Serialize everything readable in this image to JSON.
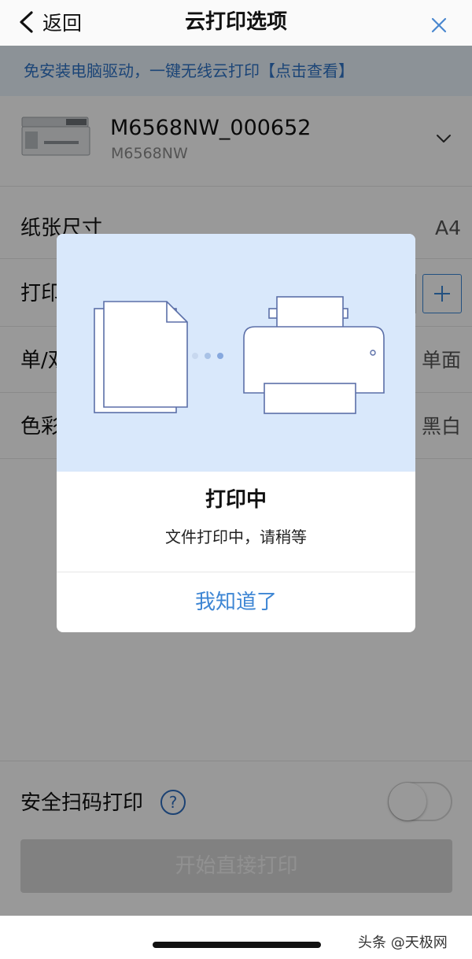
{
  "nav": {
    "back_label": "返回",
    "title": "云打印选项"
  },
  "banner": {
    "text": "免安装电脑驱动，一键无线云打印【点击查看】"
  },
  "printer": {
    "name": "M6568NW_000652",
    "model": "M6568NW"
  },
  "options": {
    "paper_size": {
      "label": "纸张尺寸",
      "value": "A4"
    },
    "copies": {
      "label": "打印",
      "plus": "+"
    },
    "duplex": {
      "label": "单/双",
      "value": "单面"
    },
    "color": {
      "label": "色彩",
      "value": "黑白"
    }
  },
  "secure": {
    "label": "安全扫码打印",
    "help": "?",
    "enabled": false
  },
  "start_button": {
    "label": "开始直接打印"
  },
  "dialog": {
    "title": "打印中",
    "message": "文件打印中，请稍等",
    "button": "我知道了"
  },
  "watermark": "头条 @天极网",
  "colors": {
    "accent": "#3e86d4",
    "banner_text": "#2f74c6",
    "dialog_header": "#d9e8fb",
    "illustration_stroke": "#5b6fa8"
  }
}
